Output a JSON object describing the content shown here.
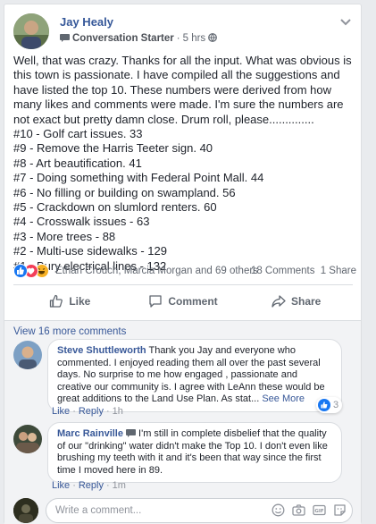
{
  "post": {
    "author": "Jay Healy",
    "badge": "Conversation Starter",
    "time": "5 hrs",
    "paragraph": "Well, that was crazy. Thanks for all the input. What was obvious is this town is passionate. I have compiled all the suggestions and have listed the top 10. These numbers were derived from how many likes and comments were made. I'm sure the numbers are not exact but pretty damn close. Drum roll, please..............",
    "list": [
      "#10 - Golf cart issues. 33",
      "#9 - Remove the Harris Teeter sign. 40",
      "#8 - Art beautification. 41",
      "#7 - Doing something with Federal Point Mall. 44",
      "#6 - No filling or building on swampland. 56",
      "#5 - Crackdown on slumlord renters. 60",
      "#4 - Crosswalk issues - 63",
      "#3 - More trees - 88",
      "#2 - Multi-use sidewalks - 129",
      "#1 - Bury electrical lines - 132"
    ]
  },
  "reactions": {
    "names": "Ethan Crouch, Marcia Morgan and 69 others",
    "comments_count": "18 Comments",
    "shares_count": "1 Share"
  },
  "actions": {
    "like": "Like",
    "comment": "Comment",
    "share": "Share"
  },
  "comments": {
    "view_more": "View 16 more comments",
    "items": [
      {
        "name": "Steve Shuttleworth",
        "text": " Thank you Jay and everyone who commented. I enjoyed reading them all over the past several days. No surprise to me how engaged , passionate and creative our community is. I agree with LeAnn these would be great additions to the Land Use Plan. As stat... ",
        "see_more": "See More",
        "like": "Like",
        "reply": "Reply",
        "time": "1h",
        "like_count": "3"
      },
      {
        "name": "Marc Rainville",
        "text": " I'm still in complete disbelief that the quality of our \"drinking\" water didn't make the Top 10. I don't even like brushing my teeth with it and it's been that way since the first time I moved here in 89.",
        "like": "Like",
        "reply": "Reply",
        "time": "1m"
      }
    ],
    "write_placeholder": "Write a comment..."
  },
  "colors": {
    "link": "#385898",
    "like_blue": "#1877f2",
    "love_red": "#f33e58",
    "haha_yellow": "#f7b125"
  },
  "icons": [
    "conversation-starter-icon",
    "globe-icon",
    "chevron-down-icon",
    "like-reaction-icon",
    "love-reaction-icon",
    "haha-reaction-icon",
    "thumbs-up-icon",
    "comment-bubble-icon",
    "share-arrow-icon",
    "emoji-icon",
    "camera-icon",
    "gif-icon",
    "sticker-icon"
  ]
}
